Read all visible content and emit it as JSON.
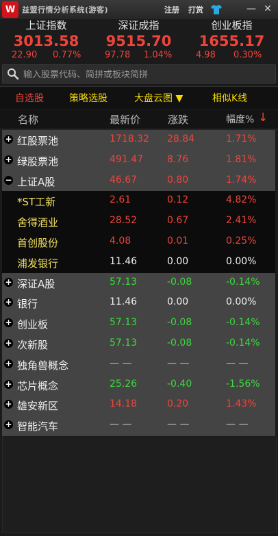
{
  "titlebar": {
    "logo_text": "W",
    "app_title": "益盟行情分析系统(游客)",
    "register": "注册",
    "donate": "打赏",
    "shirt_icon": "tshirt-icon",
    "minimize": "—",
    "close": "✕"
  },
  "indices": [
    {
      "name": "上证指数",
      "price": "3013.58",
      "change": "22.90",
      "pct": "0.77%"
    },
    {
      "name": "深证成指",
      "price": "9515.70",
      "change": "97.78",
      "pct": "1.04%"
    },
    {
      "name": "创业板指",
      "price": "1655.17",
      "change": "4.98",
      "pct": "0.30%"
    }
  ],
  "search": {
    "placeholder": "输入股票代码、简拼或板块简拼"
  },
  "tabs": [
    {
      "label": "自选股"
    },
    {
      "label": "策略选股"
    },
    {
      "label": "大盘云图 ▼"
    },
    {
      "label": "相似K线"
    }
  ],
  "table": {
    "headers": {
      "name": "名称",
      "price": "最新价",
      "change": "涨跌",
      "pct": "幅度%",
      "sort_arrow": "↓"
    },
    "rows": [
      {
        "kind": "group",
        "toggle": "+",
        "name": "红股票池",
        "price": "1718.32",
        "change": "28.84",
        "pct": "1.71%",
        "trend": "up"
      },
      {
        "kind": "group",
        "toggle": "+",
        "name": "绿股票池",
        "price": "491.47",
        "change": "8.76",
        "pct": "1.81%",
        "trend": "up"
      },
      {
        "kind": "group",
        "toggle": "−",
        "name": "上证A股",
        "price": "46.67",
        "change": "0.80",
        "pct": "1.74%",
        "trend": "up"
      },
      {
        "kind": "stock",
        "name": "*ST工新",
        "price": "2.61",
        "change": "0.12",
        "pct": "4.82%",
        "trend": "up"
      },
      {
        "kind": "stock",
        "name": "舍得酒业",
        "price": "28.52",
        "change": "0.67",
        "pct": "2.41%",
        "trend": "up"
      },
      {
        "kind": "stock",
        "name": "首创股份",
        "price": "4.08",
        "change": "0.01",
        "pct": "0.25%",
        "trend": "up"
      },
      {
        "kind": "stock",
        "name": "浦发银行",
        "price": "11.46",
        "change": "0.00",
        "pct": "0.00%",
        "trend": "flat"
      },
      {
        "kind": "group",
        "toggle": "+",
        "name": "深证A股",
        "price": "57.13",
        "change": "-0.08",
        "pct": "-0.14%",
        "trend": "down"
      },
      {
        "kind": "group",
        "toggle": "+",
        "name": "银行",
        "price": "11.46",
        "change": "0.00",
        "pct": "0.00%",
        "trend": "flat"
      },
      {
        "kind": "group",
        "toggle": "+",
        "name": "创业板",
        "price": "57.13",
        "change": "-0.08",
        "pct": "-0.14%",
        "trend": "down"
      },
      {
        "kind": "group",
        "toggle": "+",
        "name": "次新股",
        "price": "57.13",
        "change": "-0.08",
        "pct": "-0.14%",
        "trend": "down"
      },
      {
        "kind": "group",
        "toggle": "+",
        "name": "独角兽概念",
        "price": "— —",
        "change": "— —",
        "pct": "— —",
        "trend": "none"
      },
      {
        "kind": "group",
        "toggle": "+",
        "name": "芯片概念",
        "price": "25.26",
        "change": "-0.40",
        "pct": "-1.56%",
        "trend": "down"
      },
      {
        "kind": "group",
        "toggle": "+",
        "name": "雄安新区",
        "price": "14.18",
        "change": "0.20",
        "pct": "1.43%",
        "trend": "up"
      },
      {
        "kind": "group",
        "toggle": "+",
        "name": "智能汽车",
        "price": "— —",
        "change": "— —",
        "pct": "— —",
        "trend": "none"
      }
    ]
  },
  "colors": {
    "up": "#f0443b",
    "down": "#3bdb3b",
    "accent_tab": "#f5d800",
    "active_tab": "#f0443b"
  }
}
